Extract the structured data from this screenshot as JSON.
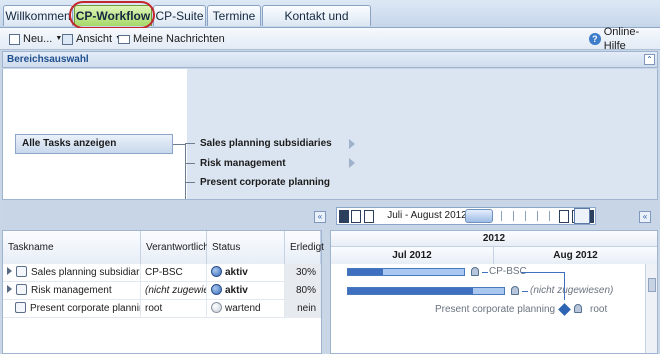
{
  "tabs": [
    {
      "label": "Willkommen",
      "active": false
    },
    {
      "label": "CP-Workflow",
      "active": true
    },
    {
      "label": "CP-Suite",
      "active": false
    },
    {
      "label": "Termine",
      "active": false
    },
    {
      "label": "Kontakt und Support",
      "active": false
    }
  ],
  "toolbar": {
    "new_label": "Neu...",
    "view_label": "Ansicht",
    "messages_label": "Meine Nachrichten",
    "help_label": "Online-Hilfe"
  },
  "area_selection": {
    "title": "Bereichsauswahl",
    "all_tasks_label": "Alle Tasks anzeigen",
    "items": [
      "Sales planning subsidiaries",
      "Risk management",
      "Present corporate planning"
    ]
  },
  "timeline_nav": {
    "period_label": "Juli - August 2012"
  },
  "task_grid": {
    "columns": [
      "Taskname",
      "Verantwortlich",
      "Status",
      "Erledigt"
    ],
    "rows": [
      {
        "task": "Sales planning subsidiaries",
        "owner": "CP-BSC",
        "status": "aktiv",
        "done": "30%"
      },
      {
        "task": "Risk management",
        "owner": "(nicht zugewie...",
        "status": "aktiv",
        "done": "80%"
      },
      {
        "task": "Present corporate planning",
        "owner": "root",
        "status": "wartend",
        "done": "nein"
      }
    ]
  },
  "gantt": {
    "year": "2012",
    "months": [
      "Jul 2012",
      "Aug 2012"
    ],
    "bar_labels": [
      "CP-BSC",
      "(nicht zugewiesen)",
      "Present corporate planning",
      "root"
    ],
    "progress": [
      0.3,
      0.8
    ]
  },
  "colors": {
    "accent": "#3f6fbf",
    "active_tab": "#a7d86a",
    "highlight_ring": "#c4262e"
  }
}
